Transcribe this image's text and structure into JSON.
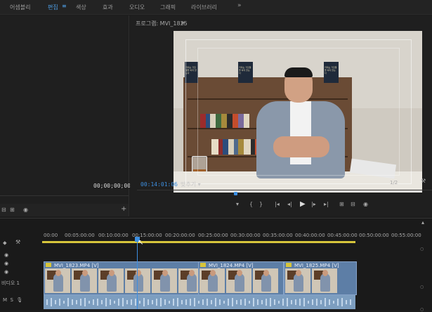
{
  "workspace_tabs": [
    {
      "label": "어셈블리"
    },
    {
      "label": "편집"
    },
    {
      "label": "색상"
    },
    {
      "label": "효과"
    },
    {
      "label": "오디오"
    },
    {
      "label": "그래픽"
    },
    {
      "label": "라이브러리"
    }
  ],
  "workspace_menu_glyph": "≡",
  "more_glyph": "»",
  "source_panel": {
    "timecode": "00;00;00;00"
  },
  "program_panel": {
    "title": "프로그램: MVI_1825",
    "title_menu": "≡",
    "timecode_current": "00:14:01:06",
    "fit_label": "맞추기",
    "fit_arrow": "▾",
    "resolution": "1/2"
  },
  "video": {
    "book_left": "카피는 거짓말을 하지 않는다",
    "book_center": "카피는 거짓말을 하지 않는다",
    "book_right": "카피는 거짓말을 하지 않는다"
  },
  "transport": {
    "mark_in": "{",
    "mark_out": "}",
    "goto_in": "|◂",
    "step_back": "◂|",
    "play": "▶",
    "step_forward": "|▸",
    "goto_out": "▸|",
    "insert": "⊞",
    "overwrite": "⊟",
    "export_frame": "◉"
  },
  "timeline": {
    "ruler_labels": [
      "00:00",
      "00:05:00:00",
      "00:10:00:00",
      "00:15:00:00",
      "00:20:00:00",
      "00:25:00:00",
      "00:30:00:00",
      "00:35:00:00",
      "00:40:00:00",
      "00:45:00:00",
      "00:50:00:00",
      "00:55:00:00"
    ],
    "track_video": "비디오 1",
    "clips": [
      {
        "label": "MVI_1823.MP4 [V]"
      },
      {
        "label": "MVI_1824.MP4 [V]"
      },
      {
        "label": "MVI_1825.MP4 [V]"
      }
    ]
  }
}
